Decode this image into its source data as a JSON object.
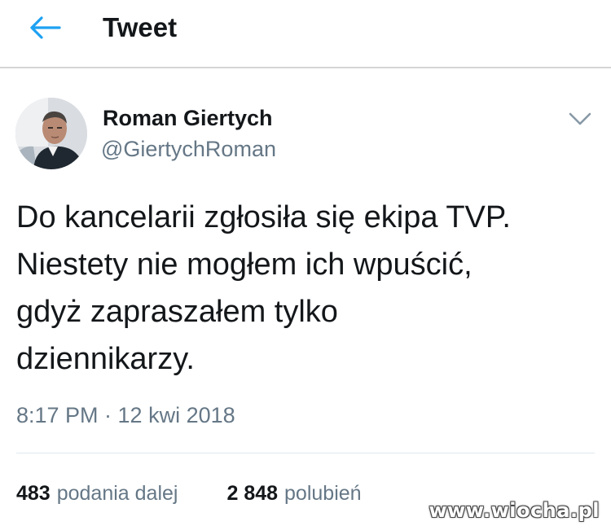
{
  "header": {
    "title": "Tweet",
    "back_icon": "arrow-left-icon"
  },
  "author": {
    "name": "Roman Giertych",
    "handle": "@GiertychRoman",
    "avatar_icon": "avatar-photo"
  },
  "tweet": {
    "text": "Do kancelarii zgłosiła się ekipa TVP.\nNiestety nie mogłem ich wpuścić,\ngdyż zapraszałem tylko\ndziennikarzy.",
    "timestamp": "8:17 PM · 12 kwi 2018"
  },
  "stats": {
    "retweets_count": "483",
    "retweets_label": "podania dalej",
    "likes_count": "2 848",
    "likes_label": "polubień"
  },
  "watermark": {
    "text": "www.wiocha.pl"
  },
  "colors": {
    "accent": "#1da1f2",
    "secondary_text": "#657786",
    "primary_text": "#14171a"
  }
}
